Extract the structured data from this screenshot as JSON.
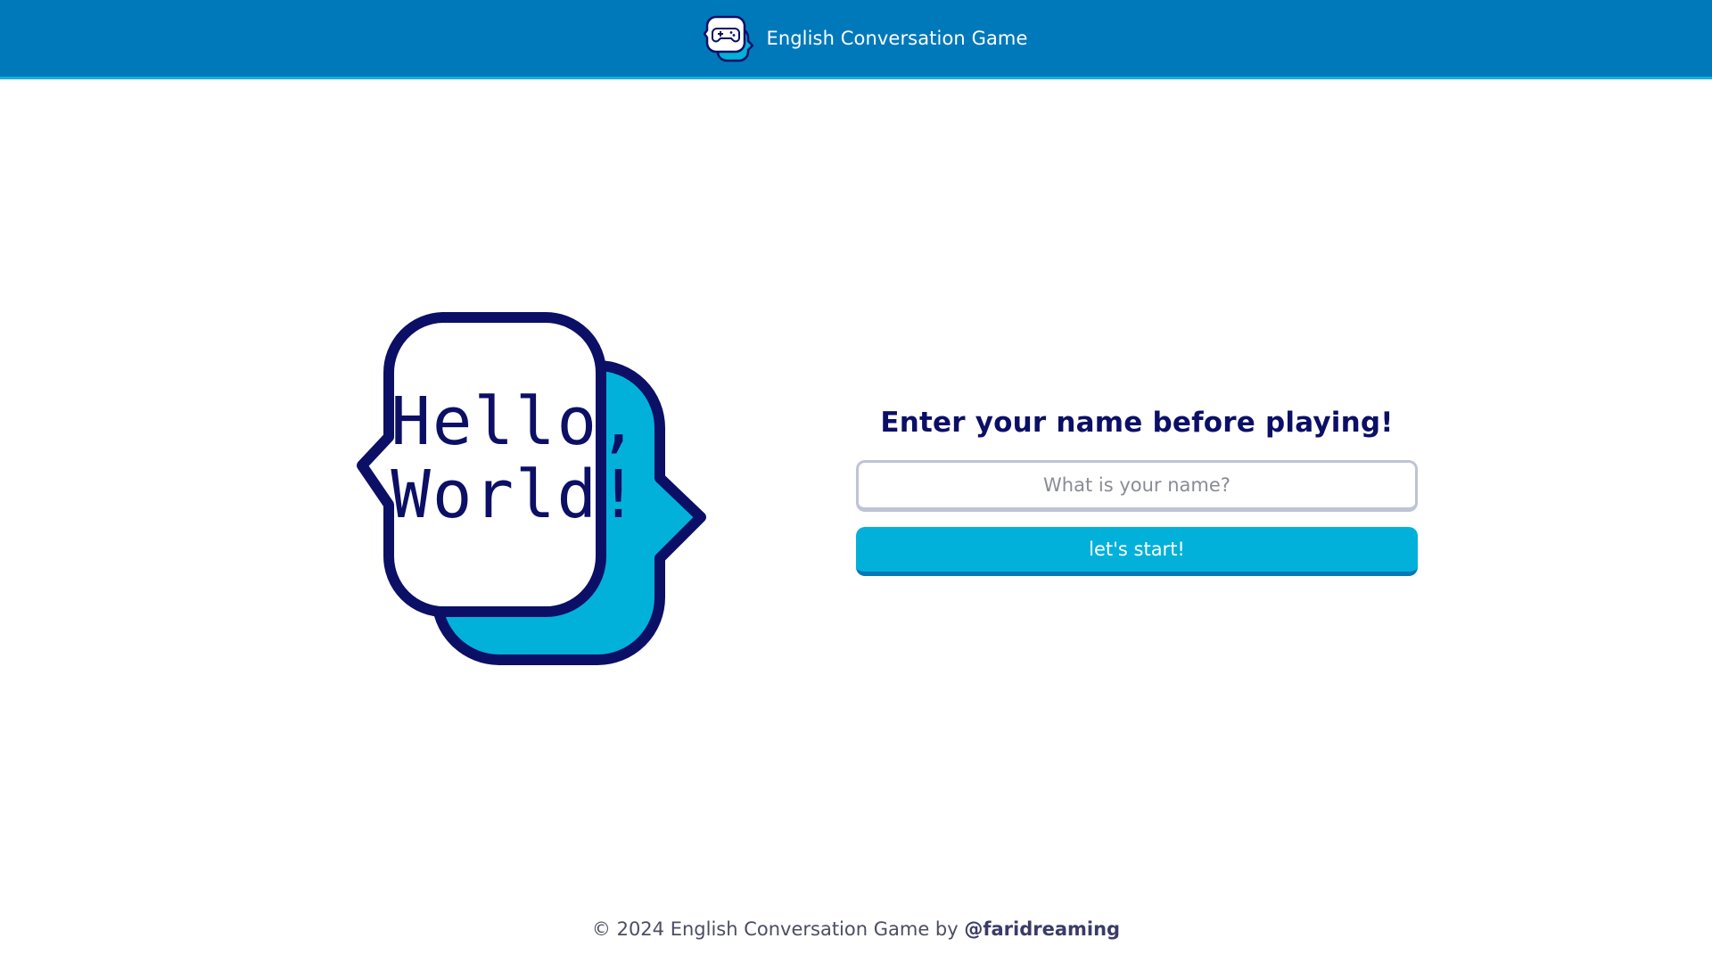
{
  "header": {
    "logo_icon": "gamepad-speech-bubble-icon",
    "title": "English Conversation Game"
  },
  "hero": {
    "icon": "speech-bubbles-icon",
    "greeting_line1": "Hello,",
    "greeting_line2": "World!"
  },
  "form": {
    "heading": "Enter your name before playing!",
    "name_placeholder": "What is your name?",
    "name_value": "",
    "start_label": "let's start!"
  },
  "footer": {
    "copyright": "© 2024 English Conversation Game by ",
    "author": "@faridreaming"
  },
  "colors": {
    "header_bg": "#0079BA",
    "accent": "#01B1DA",
    "navy": "#0B0F66",
    "button_shadow": "#0179B8"
  }
}
